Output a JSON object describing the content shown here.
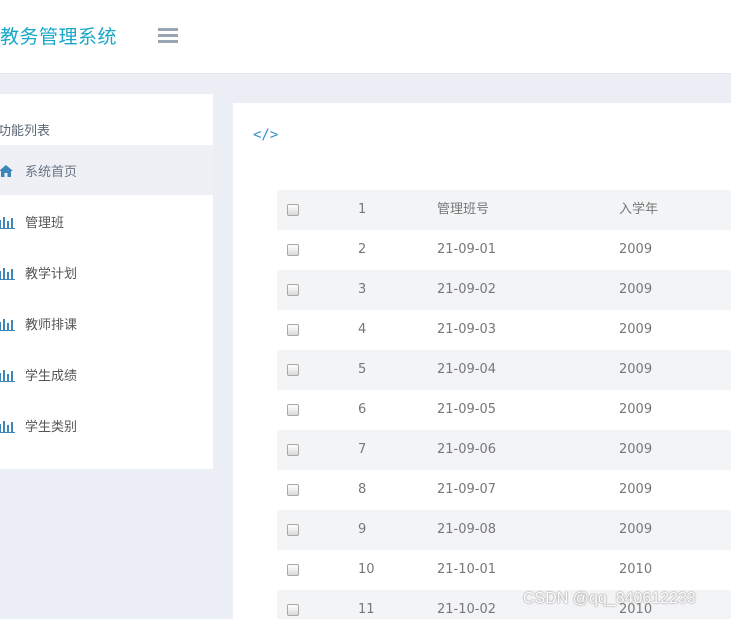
{
  "app": {
    "title": "教务管理系统"
  },
  "sidebar": {
    "header": "功能列表",
    "items": [
      {
        "label": "系统首页",
        "icon": "home-icon",
        "active": true
      },
      {
        "label": "管理班",
        "icon": "bar-chart-icon"
      },
      {
        "label": "教学计划",
        "icon": "bar-chart-icon"
      },
      {
        "label": "教师排课",
        "icon": "bar-chart-icon"
      },
      {
        "label": "学生成绩",
        "icon": "bar-chart-icon"
      },
      {
        "label": "学生类别",
        "icon": "bar-chart-icon"
      }
    ]
  },
  "content": {
    "code_icon": "</>"
  },
  "table": {
    "rows": [
      {
        "no": "1",
        "class": "管理班号",
        "year": "入学年"
      },
      {
        "no": "2",
        "class": "21-09-01",
        "year": "2009"
      },
      {
        "no": "3",
        "class": "21-09-02",
        "year": "2009"
      },
      {
        "no": "4",
        "class": "21-09-03",
        "year": "2009"
      },
      {
        "no": "5",
        "class": "21-09-04",
        "year": "2009"
      },
      {
        "no": "6",
        "class": "21-09-05",
        "year": "2009"
      },
      {
        "no": "7",
        "class": "21-09-06",
        "year": "2009"
      },
      {
        "no": "8",
        "class": "21-09-07",
        "year": "2009"
      },
      {
        "no": "9",
        "class": "21-09-08",
        "year": "2009"
      },
      {
        "no": "10",
        "class": "21-10-01",
        "year": "2010"
      },
      {
        "no": "11",
        "class": "21-10-02",
        "year": "2010"
      }
    ]
  },
  "watermark": "CSDN @qq_840612233",
  "colors": {
    "accent": "#17a7c8",
    "link": "#2d8fc7",
    "background": "#eceef5",
    "stripe": "#f3f4f6"
  }
}
